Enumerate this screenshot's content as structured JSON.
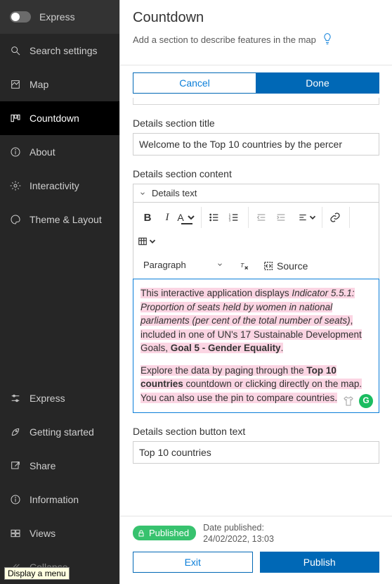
{
  "sidebar": {
    "express": "Express",
    "search_placeholder": "Search settings",
    "items": [
      {
        "label": "Map"
      },
      {
        "label": "Countdown"
      },
      {
        "label": "About"
      },
      {
        "label": "Interactivity"
      },
      {
        "label": "Theme & Layout"
      }
    ],
    "bottom": [
      {
        "label": "Express"
      },
      {
        "label": "Getting started"
      },
      {
        "label": "Share"
      },
      {
        "label": "Information"
      },
      {
        "label": "Views"
      },
      {
        "label": "Collapse"
      }
    ]
  },
  "header": {
    "title": "Countdown",
    "subtitle": "Add a section to describe features in the map"
  },
  "seg": {
    "cancel": "Cancel",
    "done": "Done"
  },
  "fields": {
    "title_label": "Details section title",
    "title_value": "Welcome to the Top 10 countries by the percer",
    "content_label": "Details section content",
    "editor_header": "Details text",
    "paragraph": "Paragraph",
    "source": "Source",
    "button_label": "Details section button text",
    "button_value": "Top 10 countries"
  },
  "content": {
    "p1a": "This interactive application displays ",
    "p1b": "Indicator 5.5.1: Proportion of seats held by women in national parliaments (per cent of the total number of seats)",
    "p1c": ", included in one of UN's 17 Sustainable Development Goals, ",
    "p1d": "Goal 5 - Gender Equality",
    "p1e": ".",
    "p2a": "Explore the data by paging through the ",
    "p2b": "Top 10 countries",
    "p2c": " countdown or clicking directly on the map. You can also use the pin to compare countries."
  },
  "footer": {
    "published": "Published",
    "date_label": "Date published:",
    "date_value": "24/02/2022, 13:03",
    "exit": "Exit",
    "publish": "Publish"
  },
  "tooltip": "Display a menu"
}
